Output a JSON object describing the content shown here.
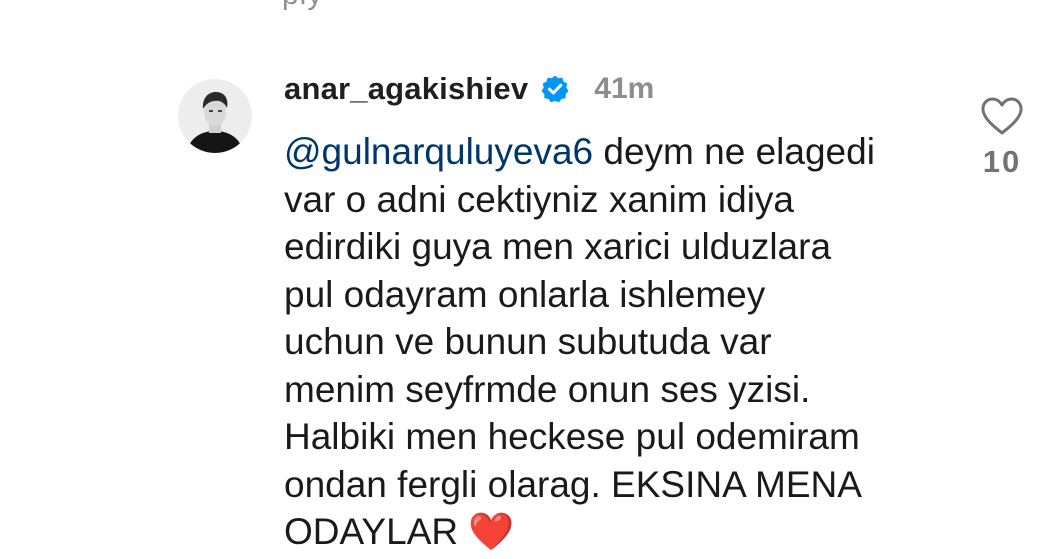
{
  "reply_fragment": "ply",
  "comment": {
    "username": "anar_agakishiev",
    "verified_icon": "verified-badge-icon",
    "time_ago": "41m",
    "mention": "@gulnarquluyeva6",
    "lines": [
      " deym ne elagedi",
      "var o adni cektiyniz xanim idiya",
      "edirdiki guya men xarici ulduzlara",
      "pul odayram onlarla ishlemey",
      "uchun ve bunun subutuda var",
      "menim seyfrmde onun ses yzisi.",
      "Halbiki men heckese pul odemiram",
      "ondan fergli olarag. EKSINA MENA",
      "ODAYLAR "
    ],
    "emoji": "❤️",
    "like_icon": "heart-outline-icon",
    "like_count": "10",
    "colors": {
      "verified": "#0095f6",
      "mention": "#00376b",
      "secondary_text": "#8e8e8e"
    }
  }
}
